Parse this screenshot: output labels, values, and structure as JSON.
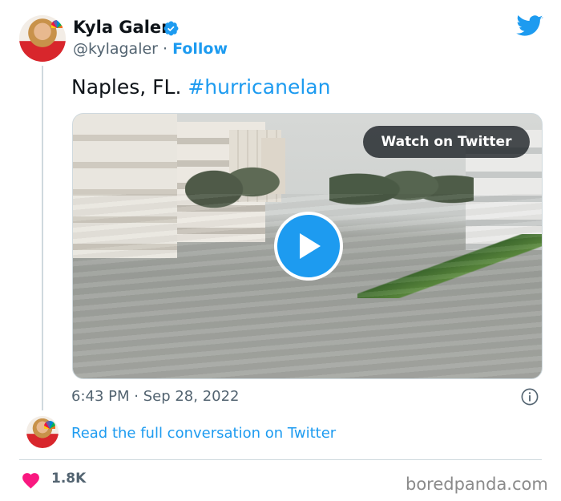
{
  "author": {
    "name": "Kyla Galer",
    "handle": "@kylagaler",
    "separator": "·",
    "follow_label": "Follow"
  },
  "tweet": {
    "text": "Naples, FL. ",
    "hashtag": "#hurricanelan",
    "timestamp": "6:43 PM · Sep 28, 2022"
  },
  "media": {
    "watch_label": "Watch on Twitter"
  },
  "conversation": {
    "read_label": "Read the full conversation on Twitter"
  },
  "engagement": {
    "likes": "1.8K"
  },
  "watermark": "boredpanda.com",
  "icons": {
    "verified": "verified-badge-icon",
    "twitter": "twitter-bird-icon",
    "play": "play-icon",
    "info": "info-icon",
    "heart": "heart-icon"
  },
  "colors": {
    "accent": "#1d9bf0",
    "heart": "#f91880",
    "text": "#0f1419",
    "muted": "#536471"
  }
}
